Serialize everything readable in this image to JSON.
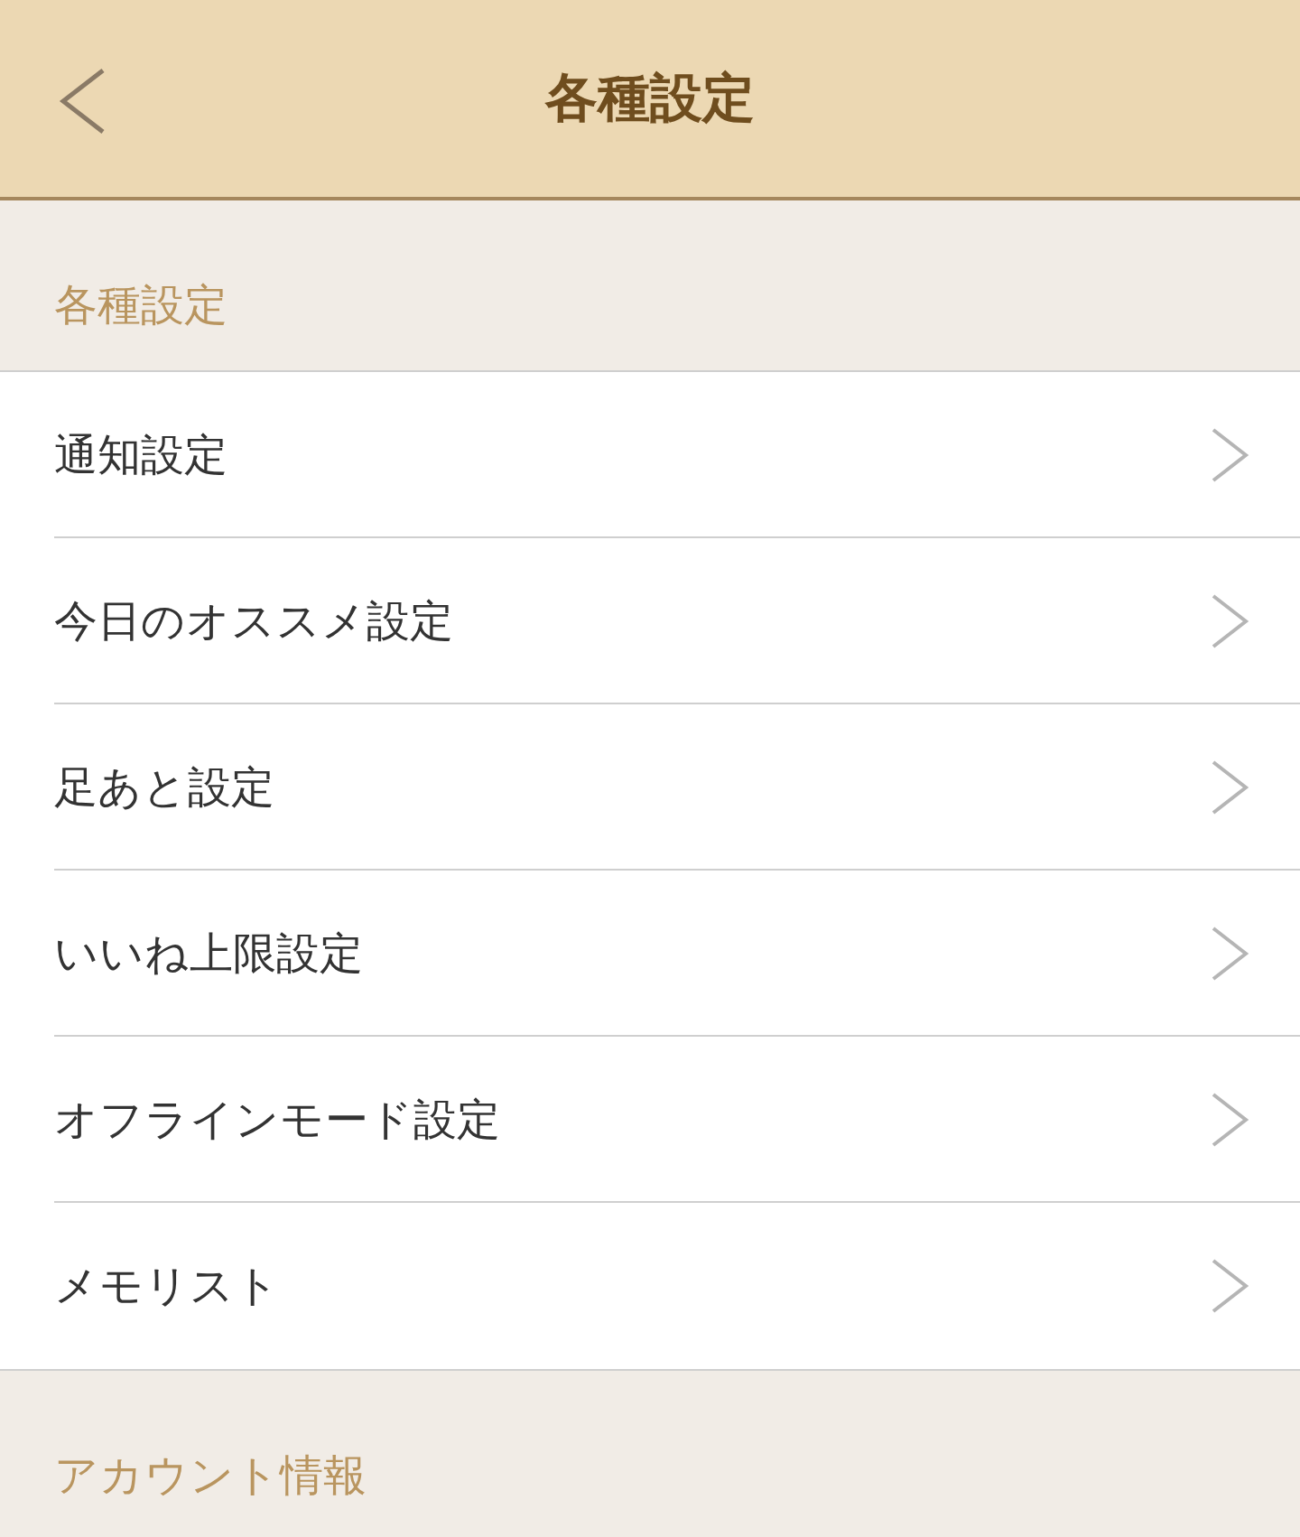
{
  "header": {
    "title": "各種設定"
  },
  "sections": [
    {
      "title": "各種設定",
      "items": [
        {
          "label": "通知設定"
        },
        {
          "label": "今日のオススメ設定"
        },
        {
          "label": "足あと設定"
        },
        {
          "label": "いいね上限設定"
        },
        {
          "label": "オフラインモード設定"
        },
        {
          "label": "メモリスト"
        }
      ]
    },
    {
      "title": "アカウント情報"
    }
  ]
}
